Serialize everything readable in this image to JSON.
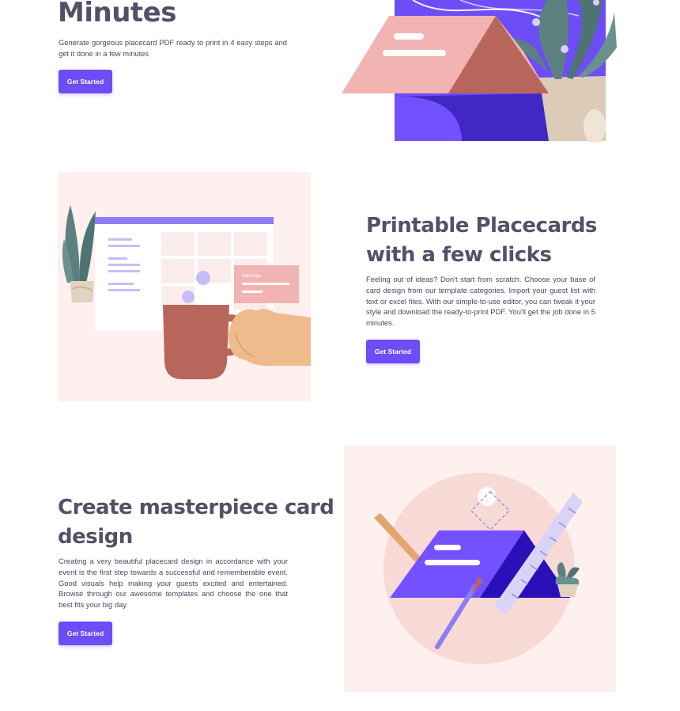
{
  "hero": {
    "title": "Minutes",
    "description": "Generate gorgeous placecard PDF ready to print in 4 easy steps and get it done in a few minutes",
    "button_label": "Get Started"
  },
  "section_printable": {
    "title_line1": "Printable Placecards",
    "title_line2": "with a few clicks",
    "description": "Feeling out of ideas? Don't start from scratch. Choose your base of card design from our template categories. Import your guest list with text or excel files. With our simple-to-use editor, you can tweak it your style and download the ready-to-print PDF. You'll get the job done in 5 minutes.",
    "button_label": "Get Started",
    "illustration_message_label": "Message"
  },
  "section_design": {
    "title_line1": "Create masterpiece card",
    "title_line2": "design",
    "description": "Creating a very beautiful placecard design in accordance with your event is the first step towards a successful and rememberable event. Good visuals help making your guests excited and entertained. Browse through our awesome templates and choose the one that best fits your big day.",
    "button_label": "Get Started"
  },
  "colors": {
    "accent": "#6c4df6",
    "heading": "#545068",
    "illustration_bg": "#fdf0ef",
    "brick": "#b8665c",
    "skin": "#f0bb8c"
  },
  "icons": {
    "hero_illustration": "envelope-plant-illustration",
    "section2_illustration": "coffee-mug-calendar-illustration",
    "section3_illustration": "card-pencil-ruler-illustration"
  }
}
